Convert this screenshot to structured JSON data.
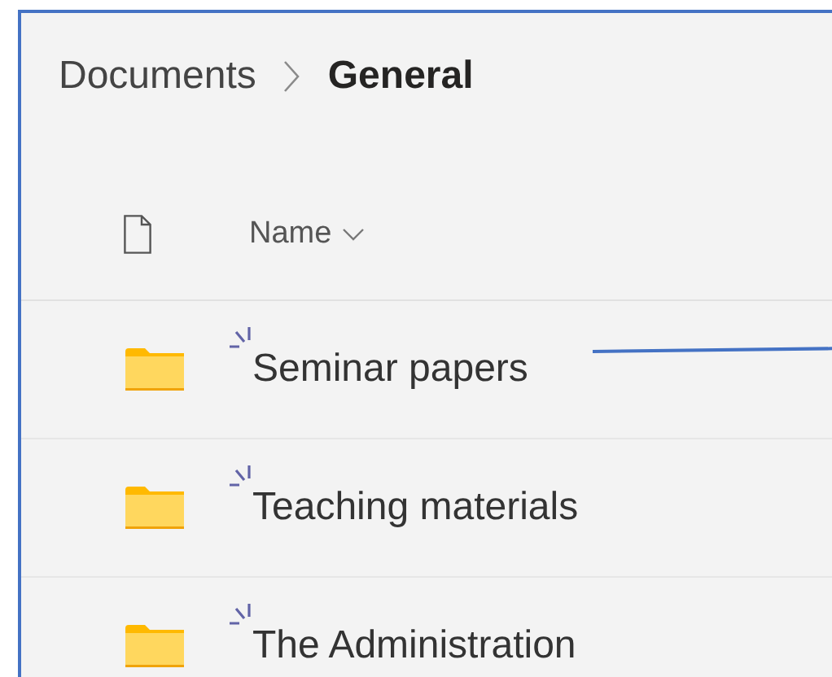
{
  "breadcrumb": [
    {
      "label": "Documents",
      "current": false
    },
    {
      "label": "General",
      "current": true
    }
  ],
  "list_header": {
    "column": "Name"
  },
  "rows": [
    {
      "name": "Seminar papers",
      "new": true
    },
    {
      "name": "Teaching materials",
      "new": true
    },
    {
      "name": "The Administration",
      "new": true
    }
  ]
}
